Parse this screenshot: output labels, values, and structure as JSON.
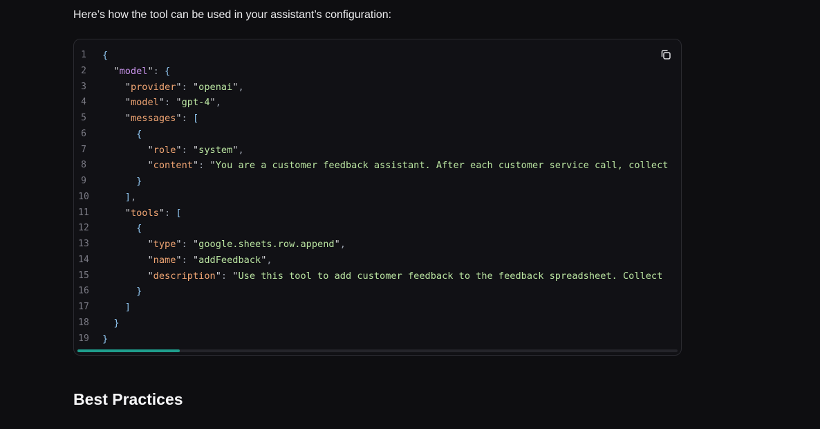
{
  "intro_text": "Here’s how the tool can be used in your assistant’s configuration:",
  "code_block": {
    "copy_icon": "copy-icon",
    "line_numbers": [
      "1",
      "2",
      "3",
      "4",
      "5",
      "6",
      "7",
      "8",
      "9",
      "10",
      "11",
      "12",
      "13",
      "14",
      "15",
      "16",
      "17",
      "18",
      "19"
    ],
    "lines": [
      "{",
      "  \"model\": {",
      "    \"provider\": \"openai\",",
      "    \"model\": \"gpt-4\",",
      "    \"messages\": [",
      "      {",
      "        \"role\": \"system\",",
      "        \"content\": \"You are a customer feedback assistant. After each customer service call, collect",
      "      }",
      "    ],",
      "    \"tools\": [",
      "      {",
      "        \"type\": \"google.sheets.row.append\",",
      "        \"name\": \"addFeedback\",",
      "        \"description\": \"Use this tool to add customer feedback to the feedback spreadsheet. Collect",
      "      }",
      "    ]",
      "  }",
      "}"
    ],
    "scroll_position": 0.0,
    "scroll_visible_fraction": 0.17,
    "colors": {
      "scroll_thumb": "#1f9e8d",
      "key_top": "#c792ea",
      "key_nested": "#f0a573",
      "string": "#b9e3a0",
      "bracket": "#8ec4ee"
    }
  },
  "section_heading": "Best Practices"
}
